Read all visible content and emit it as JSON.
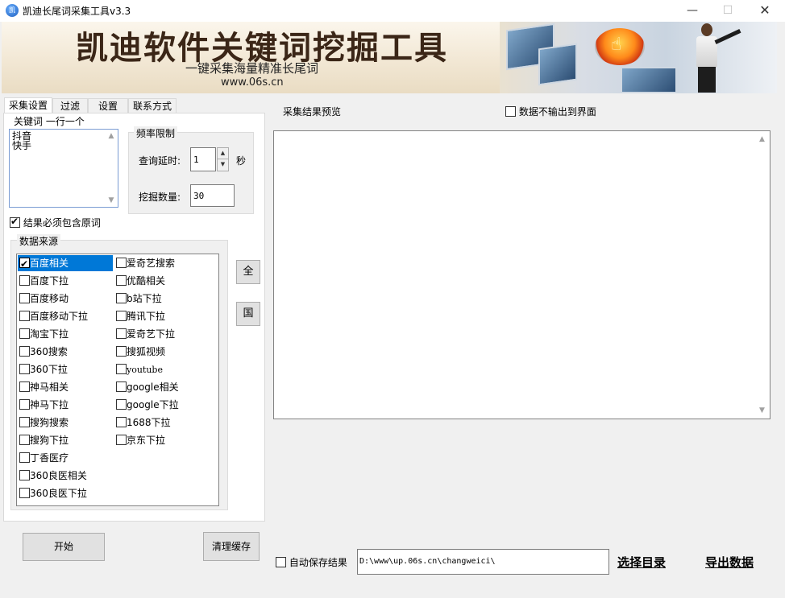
{
  "window": {
    "title": "凯迪长尾词采集工具v3.3",
    "icon_text": "凯"
  },
  "banner": {
    "title": "凯迪软件关键词挖掘工具",
    "subtitle": "一键采集海量精准长尾词",
    "url": "www.06s.cn"
  },
  "tabs": [
    {
      "label": "采集设置",
      "active": true
    },
    {
      "label": "过滤",
      "active": false
    },
    {
      "label": "设置",
      "active": false
    },
    {
      "label": "联系方式",
      "active": false
    }
  ],
  "keywords": {
    "group_label": "关键词 一行一个",
    "lines": [
      "抖音",
      "快手"
    ]
  },
  "frequency": {
    "group_label": "频率限制",
    "delay_label": "查询延时:",
    "delay_value": "1",
    "delay_unit": "秒",
    "count_label": "挖掘数量:",
    "count_value": "30"
  },
  "must_include": {
    "label": "结果必须包含原词",
    "checked": true
  },
  "sources": {
    "group_label": "数据来源",
    "left_col": [
      {
        "label": "百度相关",
        "checked": true,
        "selected": true
      },
      {
        "label": "百度下拉",
        "checked": false
      },
      {
        "label": "百度移动",
        "checked": false
      },
      {
        "label": "百度移动下拉",
        "checked": false
      },
      {
        "label": "淘宝下拉",
        "checked": false
      },
      {
        "label": "360搜索",
        "checked": false
      },
      {
        "label": "360下拉",
        "checked": false
      },
      {
        "label": "神马相关",
        "checked": false
      },
      {
        "label": "神马下拉",
        "checked": false
      },
      {
        "label": "搜狗搜索",
        "checked": false
      },
      {
        "label": "搜狗下拉",
        "checked": false
      },
      {
        "label": "丁香医疗",
        "checked": false
      },
      {
        "label": "360良医相关",
        "checked": false
      },
      {
        "label": "360良医下拉",
        "checked": false
      }
    ],
    "right_col": [
      {
        "label": "爱奇艺搜索",
        "checked": false
      },
      {
        "label": "优酷相关",
        "checked": false
      },
      {
        "label": "b站下拉",
        "checked": false
      },
      {
        "label": "腾讯下拉",
        "checked": false
      },
      {
        "label": "爱奇艺下拉",
        "checked": false
      },
      {
        "label": "搜狐视频",
        "checked": false
      },
      {
        "label": "youtube",
        "checked": false
      },
      {
        "label": "google相关",
        "checked": false
      },
      {
        "label": "google下拉",
        "checked": false
      },
      {
        "label": "1688下拉",
        "checked": false
      },
      {
        "label": "京东下拉",
        "checked": false
      }
    ],
    "select_all_label": "全",
    "domestic_label": "国"
  },
  "buttons": {
    "start": "开始",
    "clear_cache": "清理缓存",
    "choose_dir": "选择目录",
    "export": "导出数据"
  },
  "preview": {
    "label": "采集结果预览",
    "no_output_label": "数据不输出到界面",
    "no_output_checked": false
  },
  "save": {
    "auto_save_label": "自动保存结果",
    "auto_save_checked": false,
    "path": "D:\\www\\up.06s.cn\\changweici\\"
  }
}
